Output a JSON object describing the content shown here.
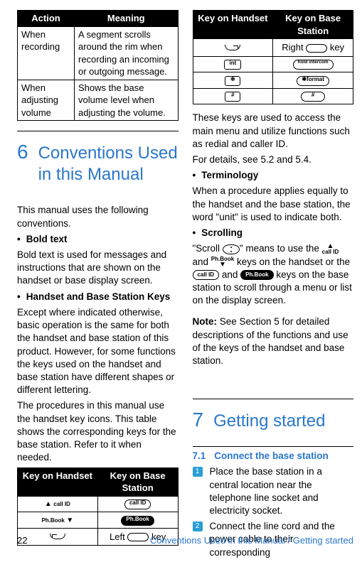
{
  "left": {
    "action_table": {
      "headers": [
        "Action",
        "Meaning"
      ],
      "rows": [
        {
          "action": "When recording",
          "meaning": "A segment scrolls around the rim when recording an incoming or outgoing message."
        },
        {
          "action": "When adjusting volume",
          "meaning": "Shows the base volume level when adjusting the volume."
        }
      ]
    },
    "sec6": {
      "num": "6",
      "title": "Conventions Used in this Manual",
      "intro": "This manual uses the following conventions.",
      "b1_title": "Bold text",
      "b1_body": "Bold text is used for messages and instructions that are shown on the handset or base display screen.",
      "b2_title": "Handset and Base Station Keys",
      "b2_body": "Except where indicated otherwise, basic operation is the same for both the handset and base station of this product. However, for some functions the keys used on the handset and base station have different shapes or different lettering.",
      "b2_body2": "The procedures in this manual use the handset key icons. This table shows the corresponding keys for the base station. Refer to it when needed.",
      "key_headers": [
        "Key on Handset",
        "Key on Base Station"
      ],
      "icon_callid": "call ID",
      "icon_phbook": "Ph.Book",
      "icon_callid_cap": "call ID",
      "icon_phbook_cap": "Ph.Book",
      "left_label": "Left",
      "key_label": "key"
    }
  },
  "right": {
    "key_headers": [
      "Key on Handset",
      "Key on Base Station"
    ],
    "right_label": "Right",
    "key_label": "key",
    "icon_int": "int",
    "icon_hold": "hold intercom",
    "icon_star": "✻",
    "icon_format": "✱format",
    "icon_hash_abc": "#",
    "icon_hash": "#",
    "para1": "These keys are used to access the main menu and utilize functions such as redial and caller ID.",
    "para2": "For details, see 5.2 and 5.4.",
    "term_title": "Terminology",
    "term_body": "When a procedure applies equally to the handset and the base station, the word \"unit\" is used to indicate both.",
    "scroll_title": "Scrolling",
    "scroll_1a": "\"Scroll ",
    "scroll_1b": "\" means to use the ",
    "scroll_1c": " and ",
    "scroll_1d": " keys on the handset or the ",
    "scroll_1e": " and ",
    "scroll_1f": " keys on the base station to scroll through a menu or list on the display screen.",
    "note_label": "Note:",
    "note_body": " See Section 5 for detailed descriptions of the functions and use of the keys of the handset and base station.",
    "sec7": {
      "num": "7",
      "title": "Getting started"
    },
    "sub71_num": "7.1",
    "sub71_title": "Connect the base station",
    "step1_num": "1",
    "step1": "Place the base station in a central location near the telephone line socket and electricity socket.",
    "step2_num": "2",
    "step2": "Connect the line cord and the power cable to their corresponding"
  },
  "footer": {
    "page": "22",
    "breadcrumb": "Conventions Used in this Manual / Getting started"
  }
}
